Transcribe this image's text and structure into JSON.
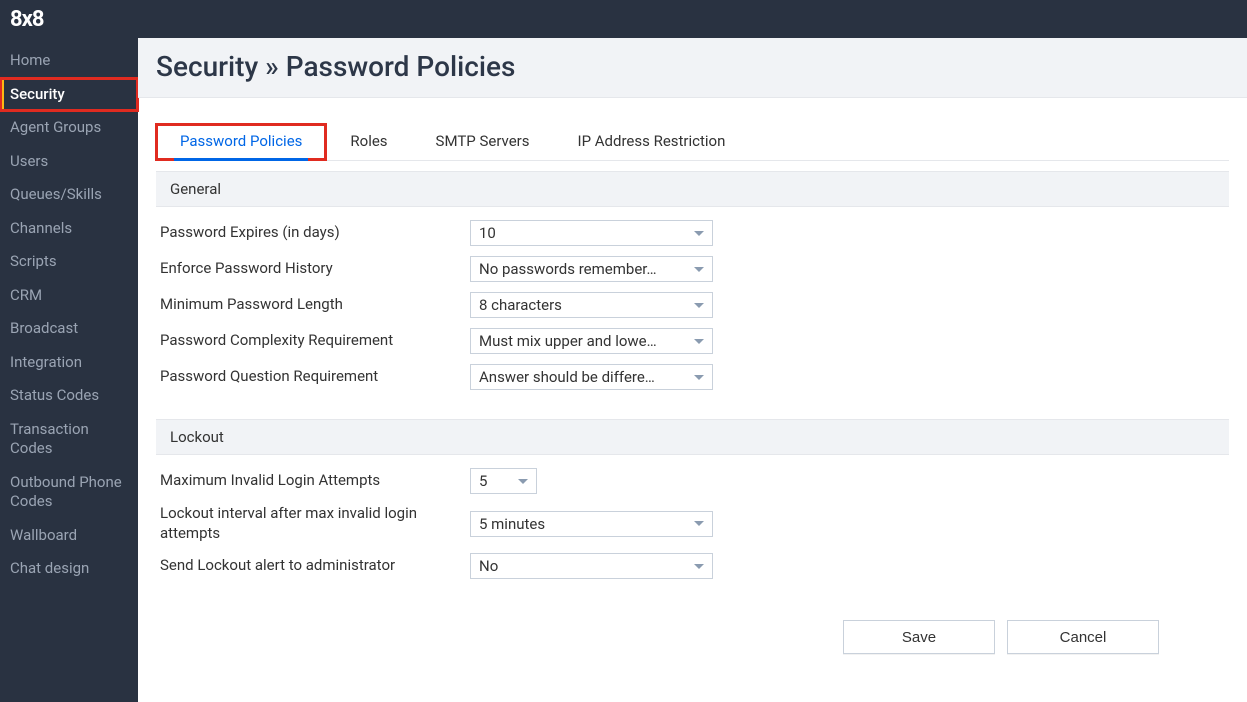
{
  "brand": "8x8",
  "sidebar": {
    "items": [
      {
        "label": "Home",
        "active": false
      },
      {
        "label": "Security",
        "active": true
      },
      {
        "label": "Agent Groups",
        "active": false
      },
      {
        "label": "Users",
        "active": false
      },
      {
        "label": "Queues/Skills",
        "active": false
      },
      {
        "label": "Channels",
        "active": false
      },
      {
        "label": "Scripts",
        "active": false
      },
      {
        "label": "CRM",
        "active": false
      },
      {
        "label": "Broadcast",
        "active": false
      },
      {
        "label": "Integration",
        "active": false
      },
      {
        "label": "Status Codes",
        "active": false
      },
      {
        "label": "Transaction Codes",
        "active": false
      },
      {
        "label": "Outbound Phone Codes",
        "active": false
      },
      {
        "label": "Wallboard",
        "active": false
      },
      {
        "label": "Chat design",
        "active": false
      }
    ]
  },
  "page": {
    "title": "Security » Password Policies"
  },
  "tabs": [
    {
      "label": "Password Policies",
      "active": true
    },
    {
      "label": "Roles",
      "active": false
    },
    {
      "label": "SMTP Servers",
      "active": false
    },
    {
      "label": "IP Address Restriction",
      "active": false
    }
  ],
  "sections": {
    "general": {
      "title": "General",
      "fields": {
        "expires": {
          "label": "Password Expires (in days)",
          "value": "10"
        },
        "history": {
          "label": "Enforce Password History",
          "value": "No passwords remember…"
        },
        "minlength": {
          "label": "Minimum Password Length",
          "value": "8 characters"
        },
        "complexity": {
          "label": "Password Complexity Requirement",
          "value": "Must mix upper and lowe…"
        },
        "question": {
          "label": "Password Question Requirement",
          "value": "Answer should be differe…"
        }
      }
    },
    "lockout": {
      "title": "Lockout",
      "fields": {
        "maxattempts": {
          "label": "Maximum Invalid Login Attempts",
          "value": "5"
        },
        "interval": {
          "label": "Lockout interval after max invalid login attempts",
          "value": "5 minutes"
        },
        "alert": {
          "label": "Send Lockout alert to administrator",
          "value": "No"
        }
      }
    }
  },
  "buttons": {
    "save": "Save",
    "cancel": "Cancel"
  }
}
